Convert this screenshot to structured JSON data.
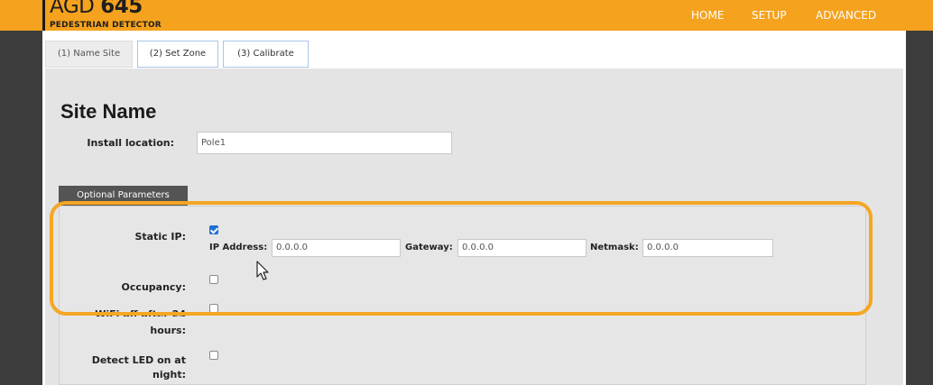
{
  "header": {
    "brand_text": "AGD",
    "brand_num": "645",
    "subtitle": "PEDESTRIAN DETECTOR",
    "nav": [
      "HOME",
      "SETUP",
      "ADVANCED"
    ]
  },
  "tabs": [
    "(1) Name Site",
    "(2) Set Zone",
    "(3) Calibrate"
  ],
  "page_title": "Site Name",
  "install_location": {
    "label": "Install location:",
    "value": "Pole1"
  },
  "optional": {
    "tab_label": "Optional Parameters",
    "static_ip": {
      "label": "Static IP:",
      "checked": true,
      "ip_label": "IP Address:",
      "ip_value": "0.0.0.0",
      "gateway_label": "Gateway:",
      "gateway_value": "0.0.0.0",
      "netmask_label": "Netmask:",
      "netmask_value": "0.0.0.0"
    },
    "occupancy": {
      "label": "Occupancy:",
      "checked": false
    },
    "wifi_off": {
      "label_line1": "WiFi off after 24",
      "label_line2": "hours:",
      "checked": false
    },
    "detect_led": {
      "label_line1": "Detect LED on at",
      "label_line2": "night:",
      "checked": false
    }
  },
  "colors": {
    "header": "#f5a21e",
    "highlight": "#f5a623",
    "checkbox": "#1f6fd1"
  }
}
